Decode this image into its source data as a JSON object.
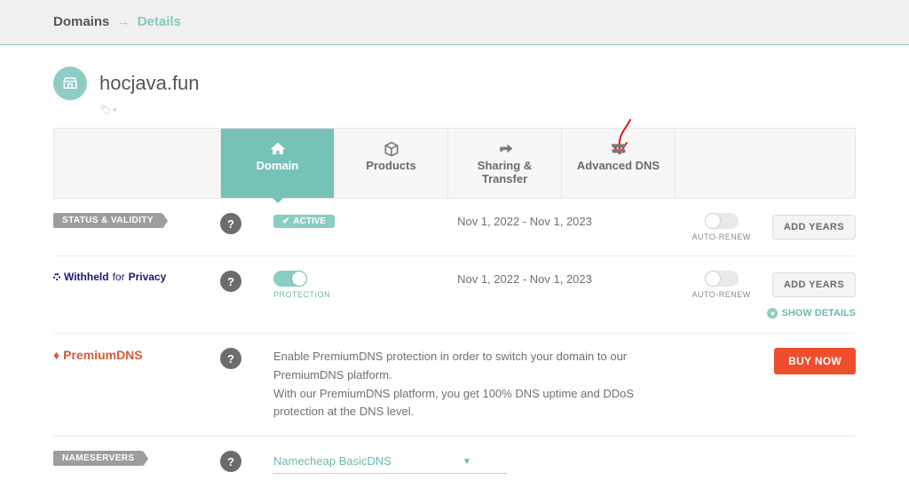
{
  "breadcrumb": {
    "first": "Domains",
    "second": "Details"
  },
  "domain_name": "hocjava.fun",
  "tagline_icon": "tag-plus",
  "tabs": {
    "domain": "Domain",
    "products": "Products",
    "sharing": "Sharing & Transfer",
    "advdns": "Advanced DNS"
  },
  "rows": {
    "status": {
      "label": "STATUS & VALIDITY",
      "chip": "ACTIVE",
      "dates": "Nov 1, 2022 - Nov 1, 2023",
      "auto_renew": "AUTO-RENEW",
      "button": "ADD YEARS"
    },
    "privacy": {
      "brand_a": "Withheld",
      "brand_b": "for",
      "brand_c": "Privacy",
      "protection": "PROTECTION",
      "dates": "Nov 1, 2022 - Nov 1, 2023",
      "auto_renew": "AUTO-RENEW",
      "button": "ADD YEARS",
      "show_details": "SHOW DETAILS"
    },
    "premium": {
      "brand": "PremiumDNS",
      "desc1": "Enable PremiumDNS protection in order to switch your domain to our PremiumDNS platform.",
      "desc2": "With our PremiumDNS platform, you get 100% DNS uptime and DDoS protection at the DNS level.",
      "button": "BUY NOW"
    },
    "nameservers": {
      "label": "NAMESERVERS",
      "value": "Namecheap BasicDNS"
    }
  }
}
